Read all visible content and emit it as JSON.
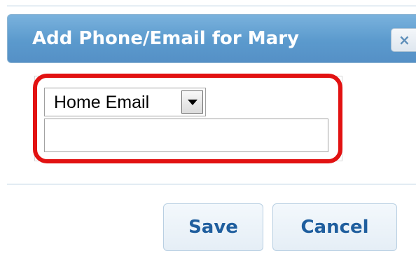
{
  "dialog": {
    "title": "Add Phone/Email for Mary",
    "close_glyph": "×"
  },
  "form": {
    "contact_type": {
      "selected": "Home Email"
    },
    "value_input": {
      "value": "",
      "placeholder": ""
    }
  },
  "actions": {
    "save_label": "Save",
    "cancel_label": "Cancel"
  },
  "colors": {
    "titlebar": "#5b9acd",
    "highlight": "#e21212",
    "button_text": "#1f5e9e"
  },
  "icons": {
    "close": "close-icon",
    "dropdown": "chevron-down-icon"
  }
}
